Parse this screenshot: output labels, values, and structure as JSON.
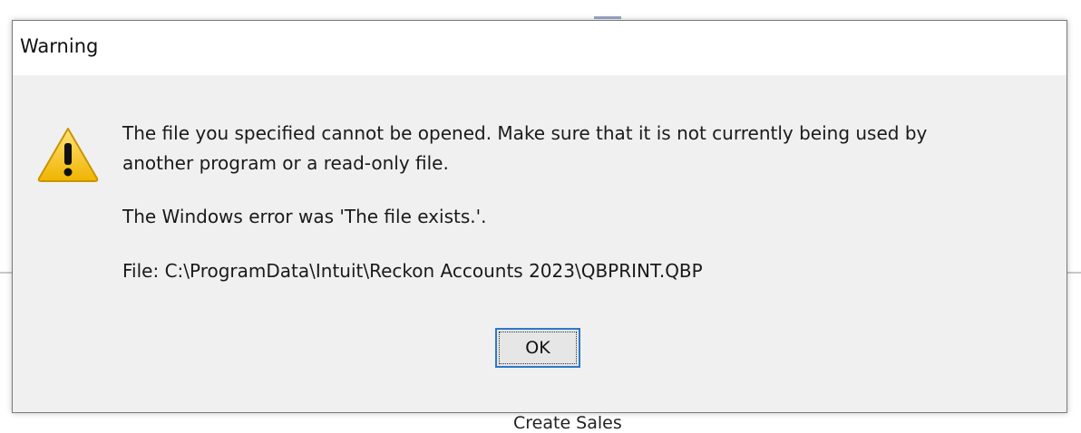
{
  "dialog": {
    "title": "Warning",
    "icon": "warning-icon",
    "message_line_1": "The file you specified cannot be opened. Make sure that it is not currently being used by",
    "message_line_2": "another program or a read-only file.",
    "windows_error": "The Windows error was 'The file exists.'.",
    "file_path": "File: C:\\ProgramData\\Intuit\\Reckon Accounts 2023\\QBPRINT.QBP",
    "ok_label": "OK"
  },
  "background": {
    "label": "Create Sales"
  },
  "colors": {
    "dialog_bg": "#f0f0f0",
    "titlebar_bg": "#ffffff",
    "button_focus_border": "#2f78c9",
    "warning_yellow": "#f5c518"
  }
}
